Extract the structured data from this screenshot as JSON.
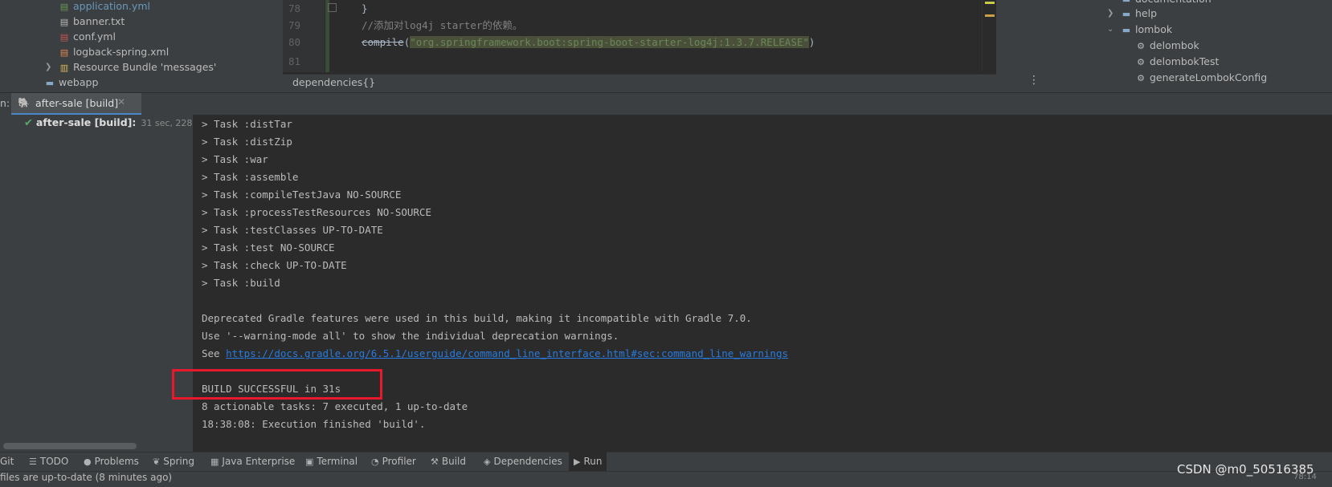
{
  "project_tree": {
    "items": [
      {
        "label": "application.yml",
        "icon": "yml-file-icon"
      },
      {
        "label": "banner.txt",
        "icon": "text-file-icon"
      },
      {
        "label": "conf.yml",
        "icon": "yml-file-icon"
      },
      {
        "label": "logback-spring.xml",
        "icon": "xml-file-icon"
      },
      {
        "label": "Resource Bundle 'messages'",
        "icon": "resource-bundle-icon"
      },
      {
        "label": "webapp",
        "icon": "folder-icon"
      }
    ]
  },
  "editor": {
    "line_numbers": [
      "78",
      "79",
      "80",
      "81"
    ],
    "lines": {
      "l78": "}",
      "l79": "//添加对log4j starter的依赖。",
      "l80_keyword": "compile",
      "l80_open": "(",
      "l80_string": "\"org.springframework.boot:spring-boot-starter-log4j:1.3.7.RELEASE\"",
      "l80_close": ")"
    },
    "breadcrumb": "dependencies{}"
  },
  "gradle_tree": {
    "items": [
      {
        "label": "documentation",
        "icon": "task-folder-icon"
      },
      {
        "label": "help",
        "icon": "task-folder-icon"
      },
      {
        "label": "lombok",
        "icon": "task-folder-icon"
      },
      {
        "label": "delombok",
        "icon": "gear-icon"
      },
      {
        "label": "delombokTest",
        "icon": "gear-icon"
      },
      {
        "label": "generateLombokConfig",
        "icon": "gear-icon"
      }
    ]
  },
  "run_panel": {
    "label": "n:",
    "tab_label": "after-sale [build]",
    "build_node": {
      "name": "after-sale [build]:",
      "time": "31 sec, 228 ms"
    }
  },
  "console": {
    "lines": [
      "> Task :distTar",
      "> Task :distZip",
      "> Task :war",
      "> Task :assemble",
      "> Task :compileTestJava NO-SOURCE",
      "> Task :processTestResources NO-SOURCE",
      "> Task :testClasses UP-TO-DATE",
      "> Task :test NO-SOURCE",
      "> Task :check UP-TO-DATE",
      "> Task :build",
      "",
      "Deprecated Gradle features were used in this build, making it incompatible with Gradle 7.0.",
      "Use '--warning-mode all' to show the individual deprecation warnings."
    ],
    "see_prefix": "See ",
    "see_link": "https://docs.gradle.org/6.5.1/userguide/command_line_interface.html#sec:command_line_warnings",
    "build_successful": "BUILD SUCCESSFUL in 31s",
    "actionable": "8 actionable tasks: 7 executed, 1 up-to-date",
    "finished": "18:38:08: Execution finished 'build'."
  },
  "tool_windows": [
    {
      "label": "Git",
      "icon": "git-icon"
    },
    {
      "label": "TODO",
      "icon": "list-icon"
    },
    {
      "label": "Problems",
      "icon": "problems-icon"
    },
    {
      "label": "Spring",
      "icon": "spring-icon"
    },
    {
      "label": "Java Enterprise",
      "icon": "java-enterprise-icon"
    },
    {
      "label": "Terminal",
      "icon": "terminal-icon"
    },
    {
      "label": "Profiler",
      "icon": "profiler-icon"
    },
    {
      "label": "Build",
      "icon": "hammer-icon"
    },
    {
      "label": "Dependencies",
      "icon": "layers-icon"
    },
    {
      "label": "Run",
      "icon": "play-icon"
    }
  ],
  "status_bar": {
    "text": "files are up-to-date (8 minutes ago)",
    "position": "78:14"
  },
  "watermark": "CSDN @m0_50516385",
  "colors": {
    "success_check": "#59a869",
    "link": "#287bde",
    "highlight_box": "#e8192c",
    "active_tab_underline": "#4a88c7"
  }
}
